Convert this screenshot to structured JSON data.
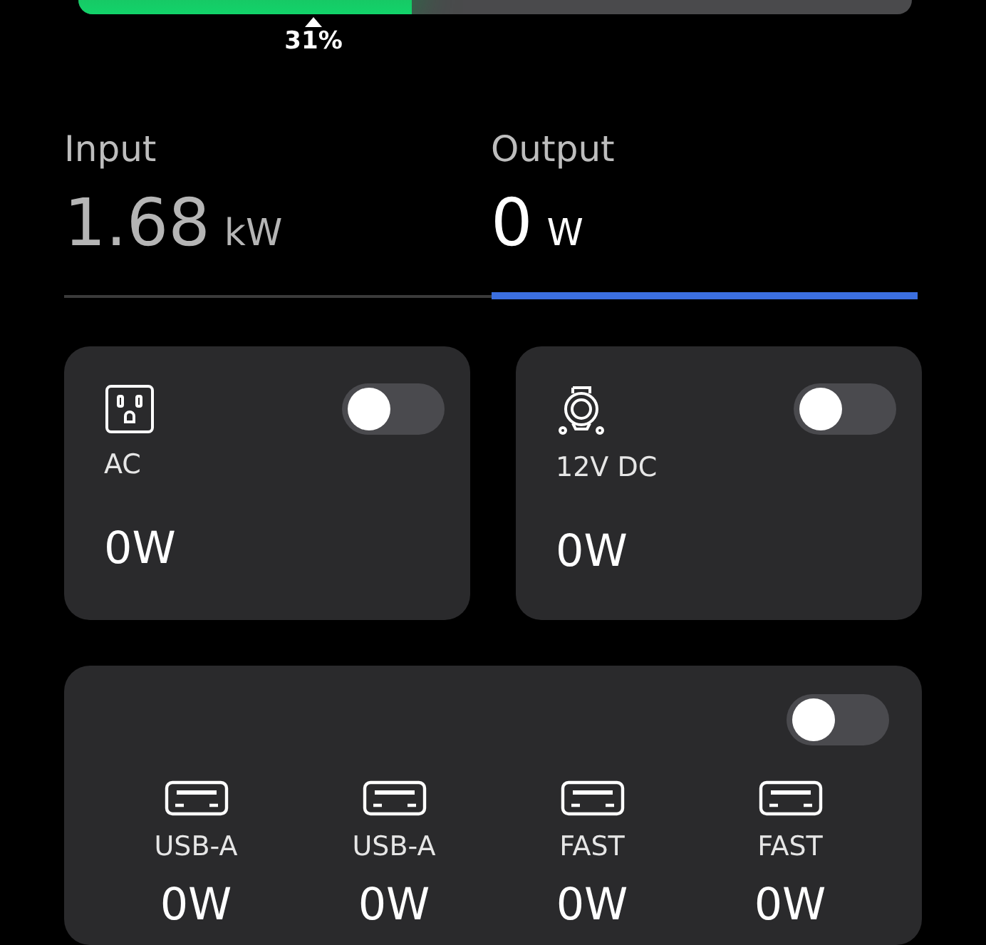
{
  "battery": {
    "level": 0.4,
    "reading": "31%"
  },
  "tabs": [
    {
      "label": "Input",
      "value": "1.68",
      "unit": "kW",
      "selected": false
    },
    {
      "label": "Output",
      "value": "0",
      "unit": "W",
      "selected": true
    }
  ],
  "ports": [
    {
      "kind": "ac",
      "label": "AC",
      "value": "0W",
      "on": false
    },
    {
      "kind": "dc",
      "label": "12V DC",
      "value": "0W",
      "on": false
    }
  ],
  "usb": {
    "on": false,
    "ports": [
      {
        "label": "USB-A",
        "value": "0W"
      },
      {
        "label": "USB-A",
        "value": "0W"
      },
      {
        "label": "FAST",
        "value": "0W"
      },
      {
        "label": "FAST",
        "value": "0W"
      }
    ]
  }
}
